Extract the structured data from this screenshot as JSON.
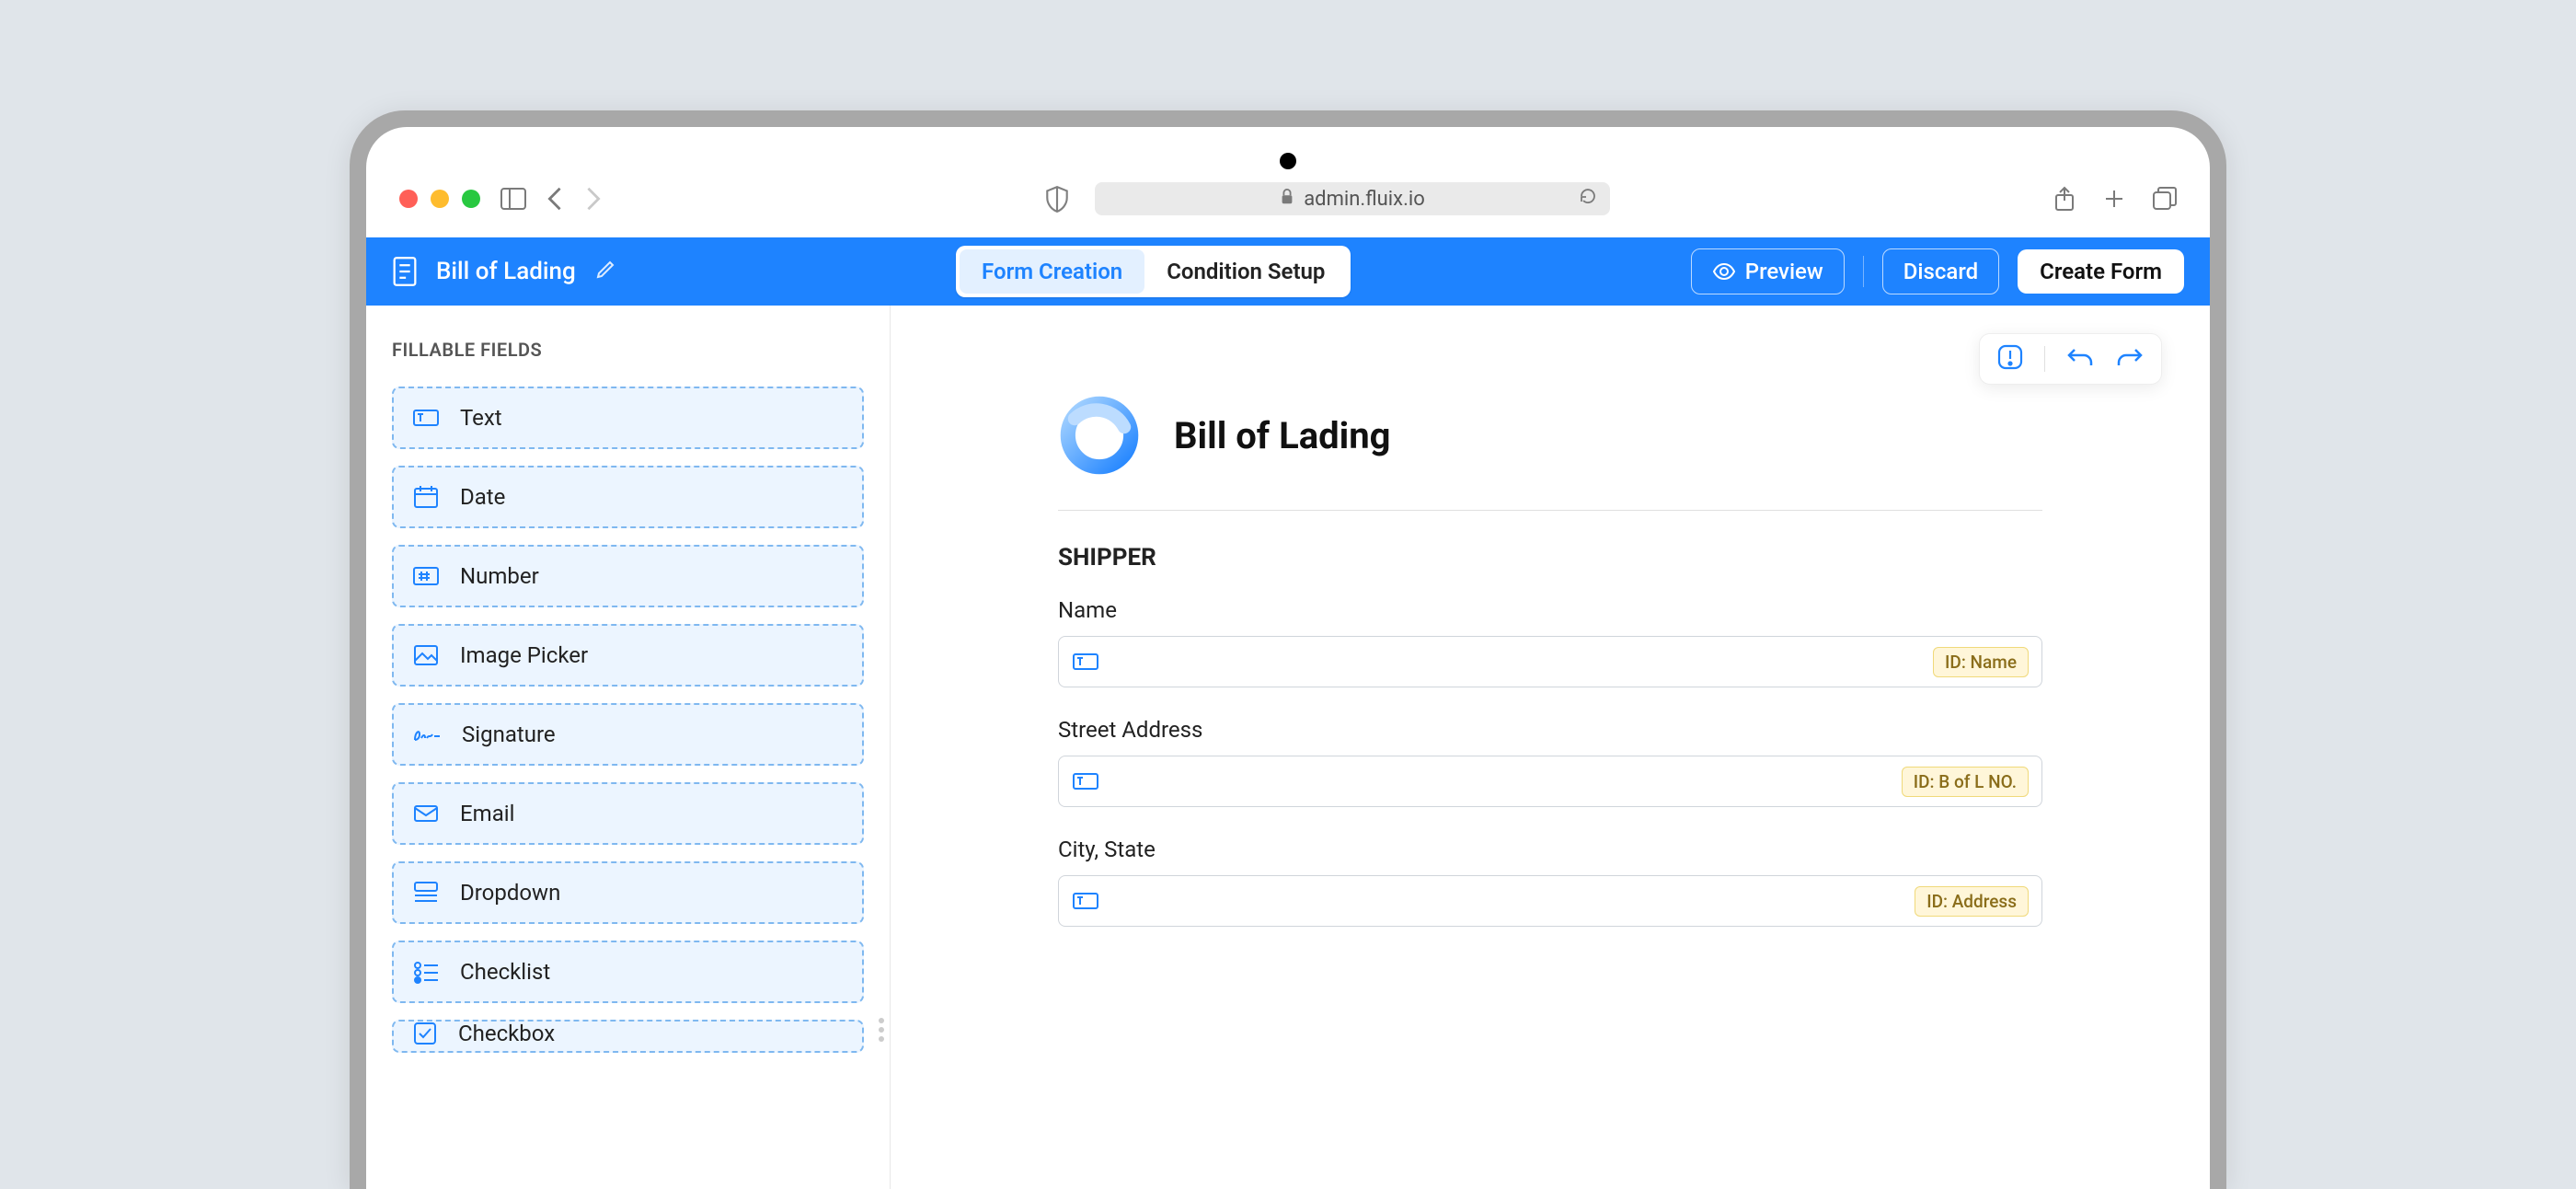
{
  "browser": {
    "url": "admin.fluix.io"
  },
  "header": {
    "title": "Bill of Lading",
    "tabs": {
      "form_creation": "Form Creation",
      "condition_setup": "Condition Setup"
    },
    "preview": "Preview",
    "discard": "Discard",
    "create": "Create Form"
  },
  "sidebar": {
    "title": "FILLABLE FIELDS",
    "items": [
      {
        "label": "Text"
      },
      {
        "label": "Date"
      },
      {
        "label": "Number"
      },
      {
        "label": "Image Picker"
      },
      {
        "label": "Signature"
      },
      {
        "label": "Email"
      },
      {
        "label": "Dropdown"
      },
      {
        "label": "Checklist"
      },
      {
        "label": "Checkbox"
      }
    ]
  },
  "document": {
    "title": "Bill of Lading",
    "section": "SHIPPER",
    "fields": [
      {
        "label": "Name",
        "id_label": "ID: Name"
      },
      {
        "label": "Street Address",
        "id_label": "ID: B of L NO."
      },
      {
        "label": "City, State",
        "id_label": "ID: Address"
      }
    ]
  }
}
